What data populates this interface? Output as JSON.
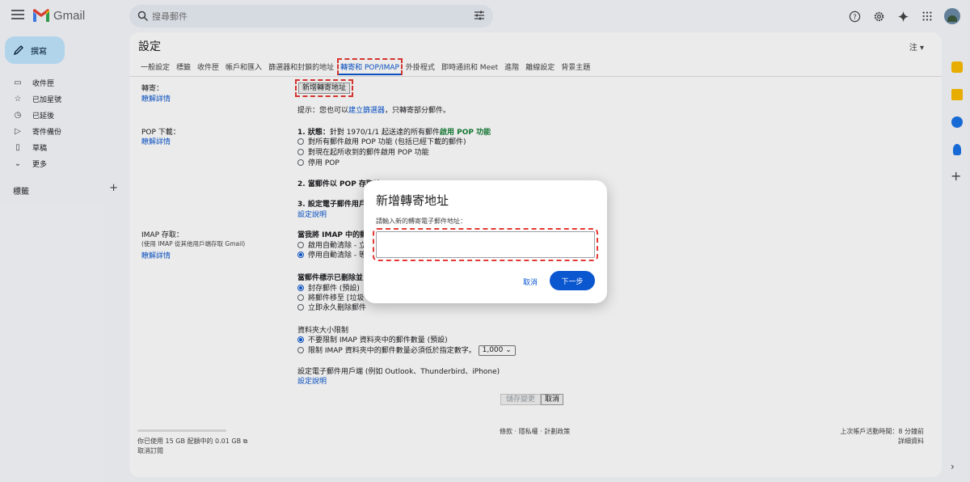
{
  "header": {
    "app_name": "Gmail",
    "search_placeholder": "搜尋郵件"
  },
  "nav": {
    "compose": "撰寫",
    "items": [
      {
        "label": "收件匣",
        "icon": "inbox-icon"
      },
      {
        "label": "已加星號",
        "icon": "star-icon"
      },
      {
        "label": "已延後",
        "icon": "clock-icon"
      },
      {
        "label": "寄件備份",
        "icon": "send-icon"
      },
      {
        "label": "草稿",
        "icon": "draft-icon"
      },
      {
        "label": "更多",
        "icon": "chevron-down-icon"
      }
    ],
    "labels_heading": "標籤",
    "labels_add": "+"
  },
  "settings": {
    "title": "設定",
    "lang": "注 ▾",
    "tabs": [
      "一般設定",
      "標籤",
      "收件匣",
      "帳戶和匯入",
      "篩選器和封鎖的地址",
      "轉寄和 POP/IMAP",
      "外掛程式",
      "即時通訊和 Meet",
      "進階",
      "離線設定",
      "背景主題"
    ],
    "forwarding": {
      "label": "轉寄：",
      "link": "瞭解詳情",
      "add_button": "新增轉寄地址",
      "tip_prefix": "提示：您也可以",
      "tip_link": "建立篩選器",
      "tip_suffix": "，只轉寄部分郵件。"
    },
    "pop": {
      "label": "POP 下載：",
      "link": "瞭解詳情",
      "status_prefix": "1. 狀態：",
      "status_text": "針對 1970/1/1 起送達的所有郵件",
      "status_green": "啟用 POP 功能",
      "options": [
        "對所有郵件啟用 POP 功能 (包括已經下載的郵件)",
        "對現在起所收到的郵件啟用 POP 功能",
        "停用 POP"
      ],
      "step2": "2. 當郵件以 POP 存取時",
      "step3": "3. 設定電子郵件用戶端",
      "setup_link": "設定說明"
    },
    "imap": {
      "label": "IMAP 存取：",
      "sub": "(使用 IMAP 從其他用戶端存取 Gmail)",
      "link": "瞭解詳情",
      "q1": "當我將 IMAP 中的郵件",
      "q1_opts": [
        "啟用自動清除 - 立",
        "停用自動清除 - 等"
      ],
      "q2": "當郵件標示已刪除並",
      "q2_opts": [
        "封存郵件 (預設)",
        "將郵件移至 [垃圾",
        "立即永久刪除郵件"
      ],
      "folder_title": "資料夾大小限制",
      "folder_opts": [
        "不要限制 IMAP 資料夾中的郵件數量 (預設)",
        "限制 IMAP 資料夾中的郵件數量必須低於指定數字。"
      ],
      "folder_limit": "1,000",
      "client_text": "設定電子郵件用戶端 (例如 Outlook、Thunderbird、iPhone)",
      "client_link": "設定說明"
    },
    "save": "儲存變更",
    "cancel": "取消"
  },
  "footer": {
    "storage": "你已使用 15 GB 配額中的 0.01 GB",
    "unsubscribe": "取消訂閱",
    "center": "條款 · 隱私權 · 計劃政策",
    "activity": "上次帳戶活動時間：8 分鐘前",
    "details": "詳細資料"
  },
  "dialog": {
    "title": "新增轉寄地址",
    "label": "請輸入新的轉寄電子郵件地址：",
    "input_value": "",
    "cancel": "取消",
    "next": "下一步"
  },
  "colors": {
    "accent": "#0b57d0",
    "highlight": "#e53935",
    "compose_bg": "#c2e7ff"
  }
}
